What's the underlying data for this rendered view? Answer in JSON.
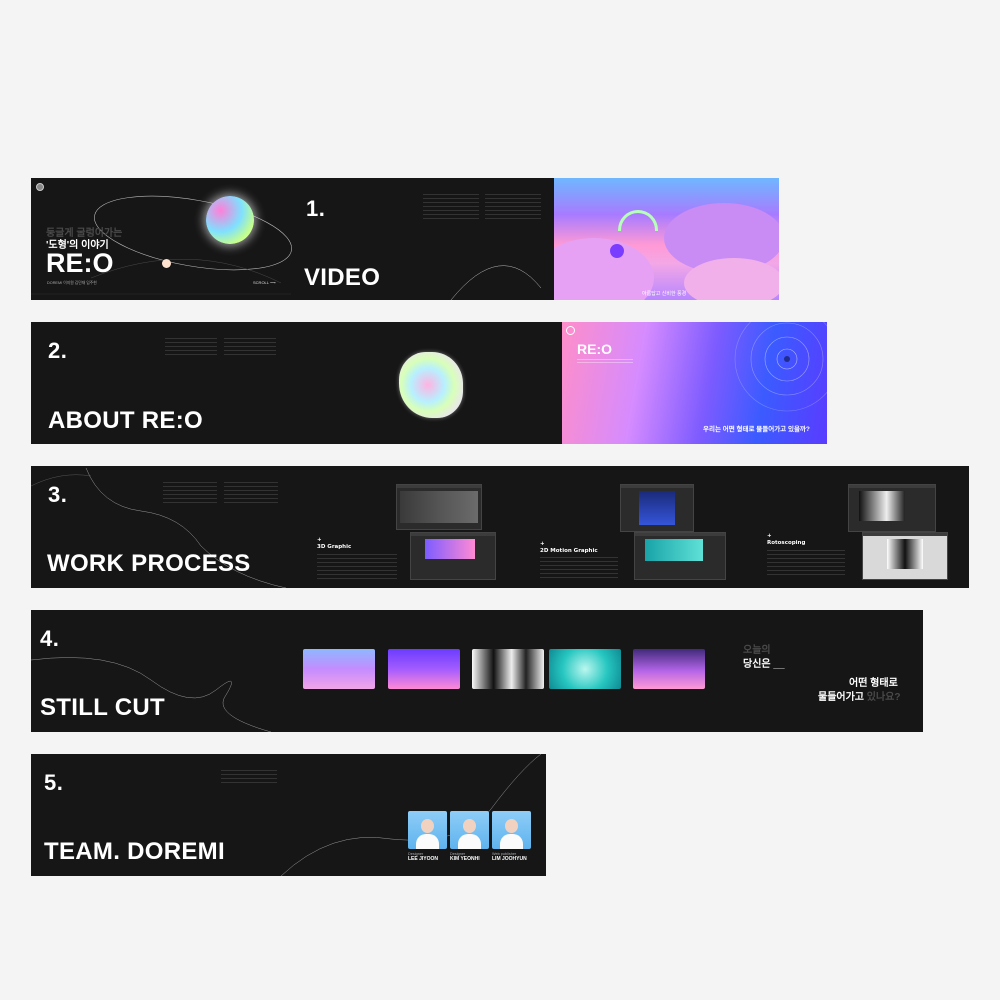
{
  "hero": {
    "kicker": "둥글게 굴렁이가는",
    "subtitle": "'도형'의 이야기",
    "title": "RE:O",
    "byline": "DOREMI  이지원 김민재 임주현",
    "scroll": "SCROLL ⟶"
  },
  "sections": [
    {
      "number": "1.",
      "title": "VIDEO"
    },
    {
      "number": "2.",
      "title": "ABOUT RE:O"
    },
    {
      "number": "3.",
      "title": "WORK PROCESS"
    },
    {
      "number": "4.",
      "title": "STILL CUT"
    },
    {
      "number": "5.",
      "title": "TEAM. DOREMI"
    }
  ],
  "video": {
    "caption": "아름답고 신비한 풍경"
  },
  "about": {
    "brand": "RE:O",
    "question": "우리는 어떤 형태로 물들어가고 있을까?"
  },
  "process": {
    "items": [
      {
        "marker": "+",
        "label": "3D Graphic"
      },
      {
        "marker": "+",
        "label": "2D Motion Graphic"
      },
      {
        "marker": "+",
        "label": "Rotoscoping"
      }
    ]
  },
  "still": {
    "line1": "오늘의",
    "line2": "당신은 __",
    "line3": "어떤 형태로",
    "line4a": "물들어가고 ",
    "line4b": "있나요?"
  },
  "team": {
    "members": [
      {
        "role": "Designer",
        "name": "LEE JIYOON"
      },
      {
        "role": "Designer",
        "name": "KIM YEONHI"
      },
      {
        "role": "Web publisher",
        "name": "LIM JOOHYUN"
      }
    ]
  },
  "colors": {
    "strip_bg": "#161616",
    "page_bg": "#f4f4f4",
    "accent_pink": "#ff9ad5",
    "accent_blue": "#3b5bff"
  }
}
